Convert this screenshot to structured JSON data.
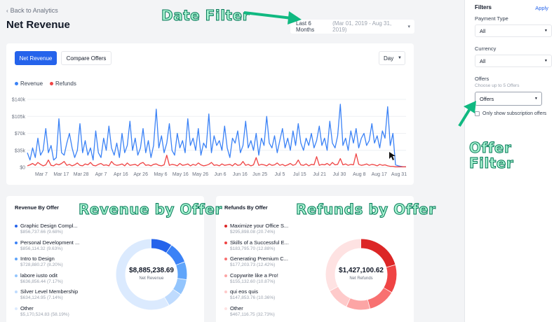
{
  "back_link": "Back to Analytics",
  "page_title": "Net Revenue",
  "date_filter": {
    "preset": "Last 6 Months",
    "range": "(Mar 01, 2019 - Aug 31, 2019)"
  },
  "annotations": {
    "date_filter": "Date Filter",
    "offer_filter_1": "Offer",
    "offer_filter_2": "Filter",
    "revenue_by_offer": "Revenue by Offer",
    "refunds_by_offer": "Refunds by Offer"
  },
  "chart_card": {
    "tab_active": "Net Revenue",
    "tab_inactive": "Compare Offers",
    "granularity": "Day"
  },
  "colors": {
    "revenue": "#3b82f6",
    "refunds": "#ef4444",
    "primary": "#2563eb",
    "annotation": "#10b981"
  },
  "chart_data": {
    "type": "line",
    "x_ticks": [
      "Mar 7",
      "Mar 17",
      "Mar 28",
      "Apr 7",
      "Apr 16",
      "Apr 26",
      "May 6",
      "May 16",
      "May 26",
      "Jun 6",
      "Jun 16",
      "Jun 25",
      "Jul 5",
      "Jul 15",
      "Jul 21",
      "Jul 30",
      "Aug 8",
      "Aug 17",
      "Aug 31"
    ],
    "y_ticks": [
      "$0",
      "$35k",
      "$70k",
      "$105k",
      "$140k"
    ],
    "ylim": [
      0,
      140000
    ],
    "legend": "top-left",
    "series": [
      {
        "name": "Revenue",
        "color": "#3b82f6",
        "values": [
          30000,
          15000,
          40000,
          20000,
          60000,
          25000,
          35000,
          80000,
          30000,
          45000,
          15000,
          20000,
          100000,
          30000,
          25000,
          50000,
          70000,
          40000,
          20000,
          35000,
          90000,
          30000,
          55000,
          25000,
          40000,
          15000,
          75000,
          30000,
          20000,
          60000,
          35000,
          85000,
          40000,
          25000,
          50000,
          20000,
          70000,
          30000,
          45000,
          95000,
          35000,
          60000,
          25000,
          40000,
          80000,
          30000,
          55000,
          20000,
          45000,
          120000,
          40000,
          65000,
          30000,
          50000,
          90000,
          35000,
          25000,
          70000,
          40000,
          55000,
          30000,
          100000,
          45000,
          60000,
          35000,
          80000,
          25000,
          50000,
          40000,
          110000,
          30000,
          65000,
          45000,
          55000,
          35000,
          85000,
          40000,
          20000,
          60000,
          50000,
          75000,
          30000,
          45000,
          95000,
          40000,
          55000,
          35000,
          70000,
          25000,
          60000,
          45000,
          105000,
          50000,
          40000,
          65000,
          30000,
          55000,
          80000,
          40000,
          60000,
          35000,
          75000,
          45000,
          90000,
          50000,
          35000,
          60000,
          45000,
          70000,
          40000,
          55000,
          85000,
          45000,
          60000,
          35000,
          95000,
          50000,
          40000,
          65000,
          130000,
          45000,
          60000,
          35000,
          75000,
          50000,
          80000,
          40000,
          60000,
          70000,
          45000,
          55000,
          90000,
          50000,
          65000,
          40000,
          75000,
          60000,
          125000,
          45000,
          70000,
          5000,
          3000,
          2000,
          1000,
          1000
        ]
      },
      {
        "name": "Refunds",
        "color": "#ef4444",
        "values": [
          3000,
          5000,
          8000,
          4000,
          10000,
          6000,
          3000,
          5000,
          15000,
          4000,
          3000,
          7000,
          5000,
          8000,
          12000,
          4000,
          6000,
          3000,
          5000,
          9000,
          4000,
          3000,
          7000,
          5000,
          10000,
          4000,
          3000,
          6000,
          8000,
          4000,
          5000,
          3000,
          12000,
          6000,
          4000,
          5000,
          7000,
          3000,
          9000,
          4000,
          5000,
          6000,
          3000,
          8000,
          10000,
          4000,
          5000,
          3000,
          6000,
          7000,
          4000,
          3000,
          5000,
          25000,
          4000,
          6000,
          5000,
          3000,
          8000,
          4000,
          5000,
          7000,
          3000,
          6000,
          4000,
          9000,
          5000,
          3000,
          4000,
          6000,
          10000,
          4000,
          5000,
          3000,
          7000,
          4000,
          5000,
          6000,
          3000,
          8000,
          4000,
          5000,
          12000,
          4000,
          6000,
          3000,
          5000,
          20000,
          4000,
          6000,
          5000,
          3000,
          7000,
          4000,
          5000,
          9000,
          4000,
          6000,
          3000,
          5000,
          8000,
          4000,
          6000,
          15000,
          5000,
          4000,
          7000,
          3000,
          6000,
          5000,
          22000,
          4000,
          6000,
          5000,
          8000,
          4000,
          10000,
          5000,
          6000,
          18000,
          5000,
          7000,
          4000,
          6000,
          5000,
          28000,
          6000,
          4000,
          5000,
          7000,
          4000,
          6000,
          5000,
          3000,
          6000,
          4000,
          5000,
          3000,
          2000,
          2000,
          1000,
          1000,
          1000,
          1000,
          1000
        ]
      }
    ]
  },
  "revenue_by_offer": {
    "title": "Revenue By Offer",
    "total": "$8,885,238.69",
    "total_label": "Net Revenue",
    "items": [
      {
        "name": "Graphic Design Compl...",
        "amount": "$856,737.66 (9.68%)",
        "color": "#2563eb",
        "pct": 9.68
      },
      {
        "name": "Personal Development ...",
        "amount": "$856,114.32 (9.63%)",
        "color": "#3b82f6",
        "pct": 9.63
      },
      {
        "name": "Intro to Design",
        "amount": "$728,880.27 (8.20%)",
        "color": "#60a5fa",
        "pct": 8.2
      },
      {
        "name": "labore iusto odit",
        "amount": "$636,856.44 (7.17%)",
        "color": "#93c5fd",
        "pct": 7.17
      },
      {
        "name": "Silver Level Membership",
        "amount": "$634,124.95 (7.14%)",
        "color": "#bfdbfe",
        "pct": 7.14
      },
      {
        "name": "Other",
        "amount": "$5,170,524.83 (58.19%)",
        "color": "#dbeafe",
        "pct": 58.19
      }
    ]
  },
  "refunds_by_offer": {
    "title": "Refunds By Offer",
    "total": "$1,427,100.62",
    "total_label": "Net Refunds",
    "items": [
      {
        "name": "Maximize your Office S...",
        "amount": "$295,898.08 (20.74%)",
        "color": "#dc2626",
        "pct": 20.74
      },
      {
        "name": "Skills of a Successful E...",
        "amount": "$183,795.70 (12.88%)",
        "color": "#ef4444",
        "pct": 12.88
      },
      {
        "name": "Generating Premium C...",
        "amount": "$177,203.73 (12.42%)",
        "color": "#f87171",
        "pct": 12.42
      },
      {
        "name": "Copywrite like a Pro!",
        "amount": "$155,132.60 (10.87%)",
        "color": "#fca5a5",
        "pct": 10.87
      },
      {
        "name": "qui eos quis",
        "amount": "$147,853.76 (10.36%)",
        "color": "#fecaca",
        "pct": 10.36
      },
      {
        "name": "Other",
        "amount": "$467,116.75 (32.73%)",
        "color": "#fee2e2",
        "pct": 32.73
      }
    ]
  },
  "sidebar": {
    "heading": "Filters",
    "apply": "Apply",
    "payment_type_label": "Payment Type",
    "payment_type_value": "All",
    "currency_label": "Currency",
    "currency_value": "All",
    "offers_label": "Offers",
    "offers_hint": "Choose up to 5 Offers",
    "offers_value": "Offers",
    "subscription_label": "Only show subscription offers"
  }
}
